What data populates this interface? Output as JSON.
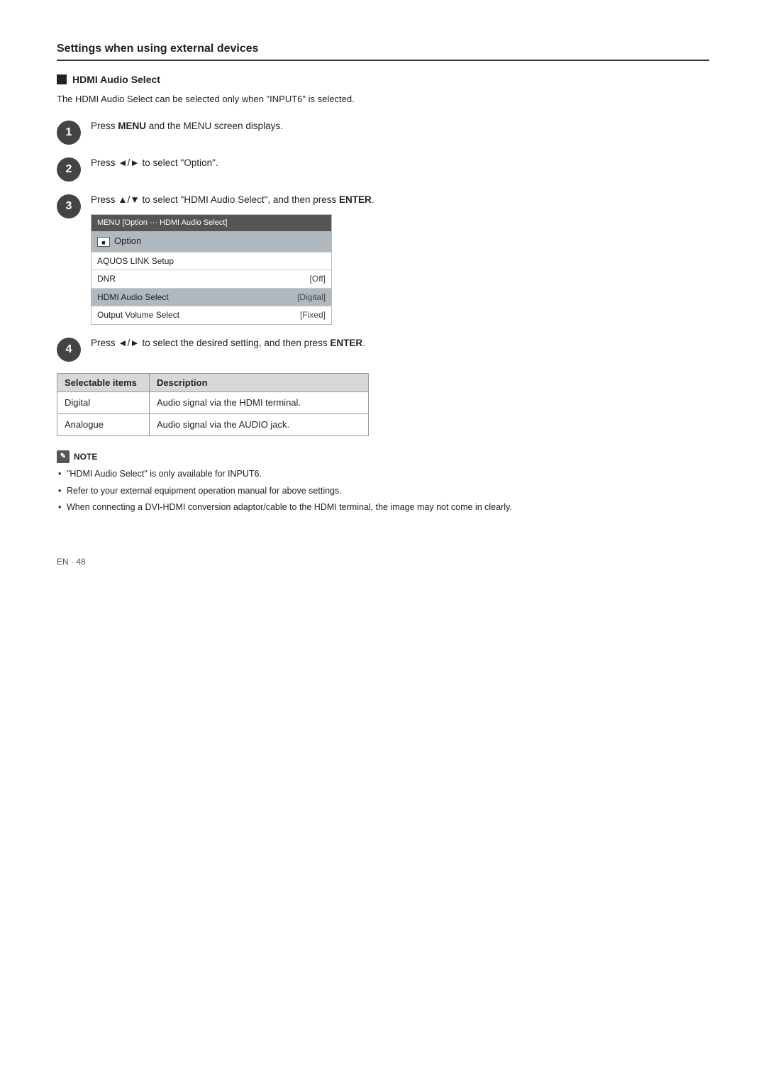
{
  "page": {
    "section_title": "Settings when using external devices",
    "subsection_title": "HDMI Audio Select",
    "intro_text": "The HDMI Audio Select can be selected only when \"INPUT6\" is selected.",
    "steps": [
      {
        "number": "1",
        "text_prefix": "Press ",
        "bold_text": "MENU",
        "text_suffix": " and the MENU screen displays."
      },
      {
        "number": "2",
        "text_prefix": "Press ",
        "arrow": "◄/►",
        "text_suffix": " to select \"Option\"."
      },
      {
        "number": "3",
        "text_prefix": "Press ",
        "arrow": "▲/▼",
        "text_suffix": " to select \"HDMI Audio Select\", and then press ",
        "bold_end": "ENTER",
        "text_end": "."
      },
      {
        "number": "4",
        "text_prefix": "Press ",
        "arrow": "◄/►",
        "text_suffix": " to select the desired setting, and then press ",
        "bold_end": "ENTER",
        "text_end": "."
      }
    ],
    "menu": {
      "header": "MENU   [Option ··· HDMI Audio Select]",
      "option_label": "Option",
      "rows": [
        {
          "label": "AQUOS LINK Setup",
          "value": ""
        },
        {
          "label": "DNR",
          "value": "[Off]"
        },
        {
          "label": "HDMI Audio Select",
          "value": "[Digital]"
        },
        {
          "label": "Output Volume Select",
          "value": "[Fixed]"
        }
      ]
    },
    "selectable_table": {
      "header_col1": "Selectable items",
      "header_col2": "Description",
      "rows": [
        {
          "item": "Digital",
          "description": "Audio signal via the HDMI terminal."
        },
        {
          "item": "Analogue",
          "description": "Audio signal via the AUDIO jack."
        }
      ]
    },
    "note": {
      "label": "NOTE",
      "items": [
        "\"HDMI Audio Select\" is only available for INPUT6.",
        "Refer to your external equipment operation manual for above settings.",
        "When connecting a DVI-HDMI conversion adaptor/cable to the HDMI terminal, the image may not come in clearly."
      ]
    },
    "footer": "EN · 48"
  }
}
